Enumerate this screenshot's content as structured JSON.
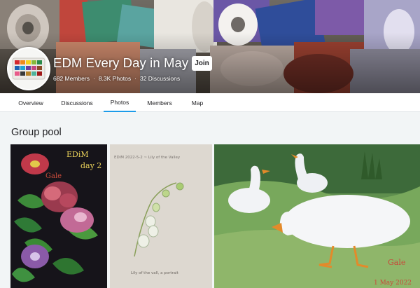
{
  "group": {
    "title": "EDM Every Day in May",
    "join_label": "Join",
    "members": "682 Members",
    "photos": "8.3K Photos",
    "discussions": "32 Discussions"
  },
  "tabs": [
    {
      "label": "Overview"
    },
    {
      "label": "Discussions"
    },
    {
      "label": "Photos"
    },
    {
      "label": "Members"
    },
    {
      "label": "Map"
    }
  ],
  "active_tab": "Photos",
  "pool": {
    "title": "Group pool"
  },
  "photos": [
    {
      "caption_lines": [
        "EDiM",
        "day 2",
        "Gale"
      ]
    },
    {
      "header": "EDiM 2022-5-2 ~ Lily of the Valley",
      "caption": "Lily of the vall, a portrait"
    },
    {
      "signature": "Gale",
      "date": "1 May 2022"
    }
  ],
  "colors": {
    "accent": "#1c9be9",
    "page_bg": "#f2f5f6",
    "text": "#212124"
  },
  "icons": {
    "avatar": "watercolor-palette-icon"
  }
}
